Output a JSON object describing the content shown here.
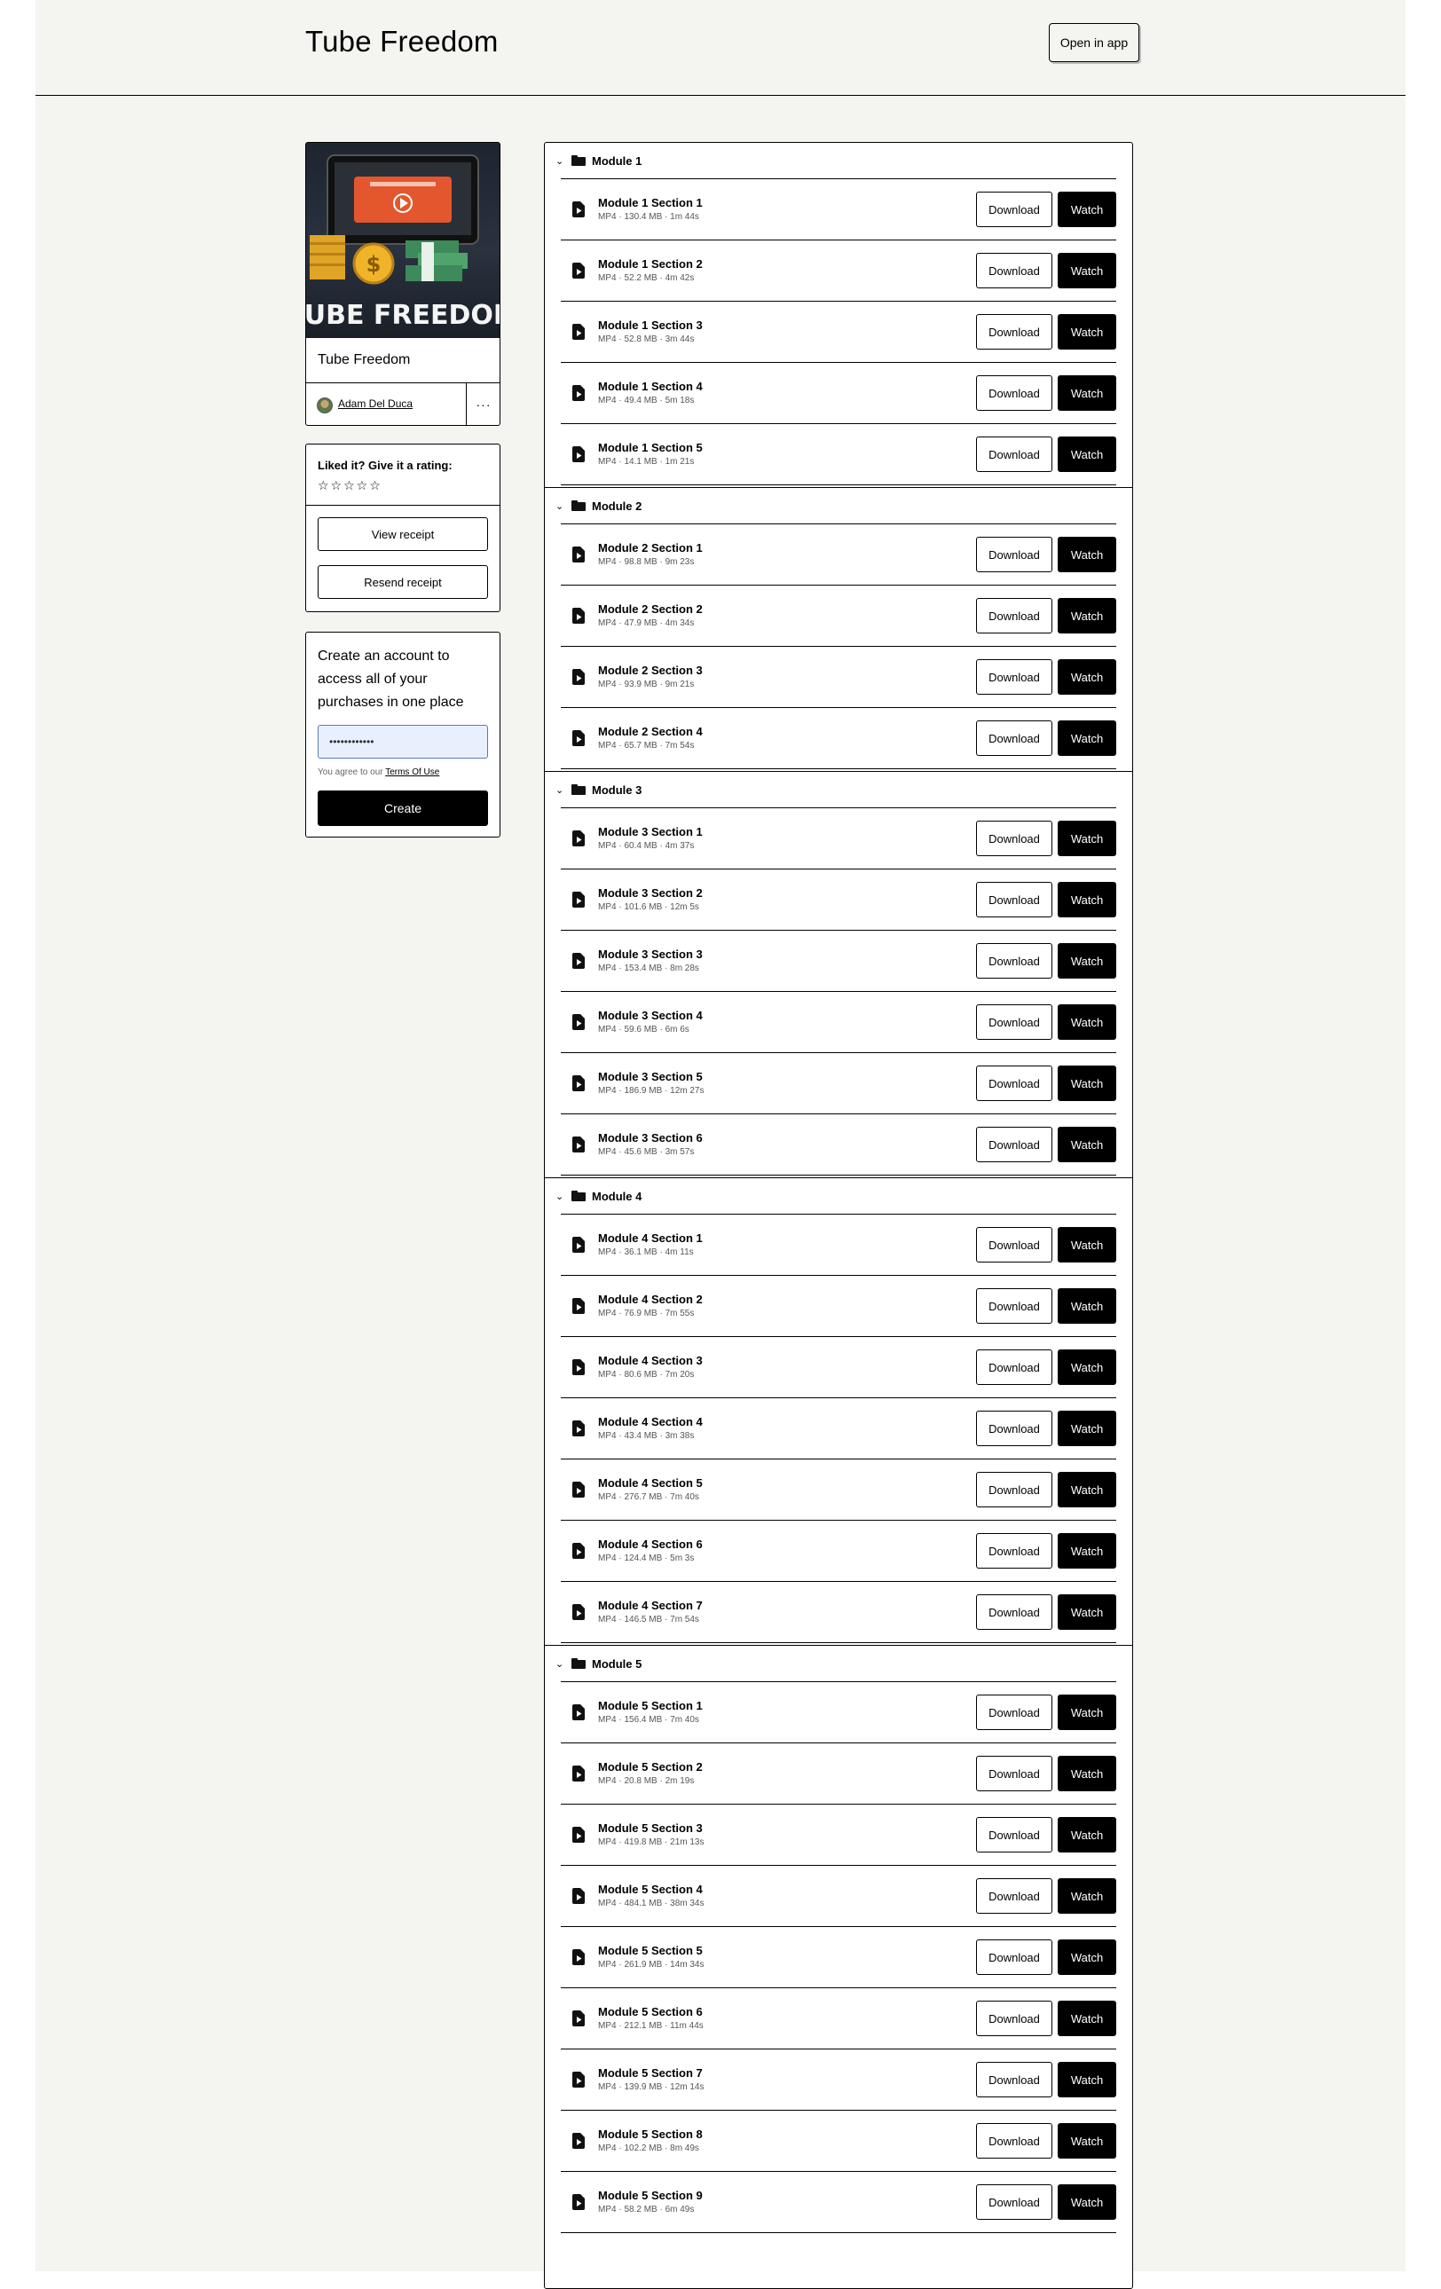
{
  "header": {
    "title": "Tube Freedom",
    "open_app_label": "Open in app"
  },
  "product": {
    "name": "Tube Freedom",
    "thumbnail_title": "TUBE FREEDOM",
    "seller": "Adam Del Duca",
    "more_label": "···"
  },
  "rating": {
    "label": "Liked it? Give it a rating:",
    "stars": "☆☆☆☆☆",
    "view_receipt": "View receipt",
    "resend_receipt": "Resend receipt"
  },
  "account": {
    "text": "Create an account to access all of your purchases in one place",
    "password_value": "••••••••••••",
    "terms_prefix": "You agree to our",
    "terms_link": "Terms Of Use",
    "create_label": "Create"
  },
  "labels": {
    "download": "Download",
    "watch": "Watch"
  },
  "modules": [
    {
      "name": "Module 1",
      "files": [
        {
          "name": "Module 1 Section 1",
          "meta": "MP4 · 130.4 MB · 1m 44s"
        },
        {
          "name": "Module 1 Section 2",
          "meta": "MP4 · 52.2 MB · 4m 42s"
        },
        {
          "name": "Module 1 Section 3",
          "meta": "MP4 · 52.8 MB · 3m 44s"
        },
        {
          "name": "Module 1 Section 4",
          "meta": "MP4 · 49.4 MB · 5m 18s"
        },
        {
          "name": "Module 1 Section 5",
          "meta": "MP4 · 14.1 MB · 1m 21s"
        }
      ]
    },
    {
      "name": "Module 2",
      "files": [
        {
          "name": "Module 2 Section 1",
          "meta": "MP4 · 98.8 MB · 9m 23s"
        },
        {
          "name": "Module 2 Section 2",
          "meta": "MP4 · 47.9 MB · 4m 34s"
        },
        {
          "name": "Module 2 Section 3",
          "meta": "MP4 · 93.9 MB · 9m 21s"
        },
        {
          "name": "Module 2 Section 4",
          "meta": "MP4 · 65.7 MB · 7m 54s"
        }
      ]
    },
    {
      "name": "Module 3",
      "files": [
        {
          "name": "Module 3 Section 1",
          "meta": "MP4 · 60.4 MB · 4m 37s"
        },
        {
          "name": "Module 3 Section 2",
          "meta": "MP4 · 101.6 MB · 12m 5s"
        },
        {
          "name": "Module 3 Section 3",
          "meta": "MP4 · 153.4 MB · 8m 28s"
        },
        {
          "name": "Module 3 Section 4",
          "meta": "MP4 · 59.6 MB · 6m 6s"
        },
        {
          "name": "Module 3 Section 5",
          "meta": "MP4 · 186.9 MB · 12m 27s"
        },
        {
          "name": "Module 3 Section 6",
          "meta": "MP4 · 45.6 MB · 3m 57s"
        }
      ]
    },
    {
      "name": "Module 4",
      "files": [
        {
          "name": "Module 4 Section 1",
          "meta": "MP4 · 36.1 MB · 4m 11s"
        },
        {
          "name": "Module 4 Section 2",
          "meta": "MP4 · 76.9 MB · 7m 55s"
        },
        {
          "name": "Module 4 Section 3",
          "meta": "MP4 · 80.6 MB · 7m 20s"
        },
        {
          "name": "Module 4 Section 4",
          "meta": "MP4 · 43.4 MB · 3m 38s"
        },
        {
          "name": "Module 4 Section 5",
          "meta": "MP4 · 276.7 MB · 7m 40s"
        },
        {
          "name": "Module 4 Section 6",
          "meta": "MP4 · 124.4 MB · 5m 3s"
        },
        {
          "name": "Module 4 Section 7",
          "meta": "MP4 · 146.5 MB · 7m 54s"
        }
      ]
    },
    {
      "name": "Module 5",
      "files": [
        {
          "name": "Module 5 Section 1",
          "meta": "MP4 · 156.4 MB · 7m 40s"
        },
        {
          "name": "Module 5 Section 2",
          "meta": "MP4 · 20.8 MB · 2m 19s"
        },
        {
          "name": "Module 5 Section 3",
          "meta": "MP4 · 419.8 MB · 21m 13s"
        },
        {
          "name": "Module 5 Section 4",
          "meta": "MP4 · 484.1 MB · 38m 34s"
        },
        {
          "name": "Module 5 Section 5",
          "meta": "MP4 · 261.9 MB · 14m 34s"
        },
        {
          "name": "Module 5 Section 6",
          "meta": "MP4 · 212.1 MB · 11m 44s"
        },
        {
          "name": "Module 5 Section 7",
          "meta": "MP4 · 139.9 MB · 12m 14s"
        },
        {
          "name": "Module 5 Section 8",
          "meta": "MP4 · 102.2 MB · 8m 49s"
        },
        {
          "name": "Module 5 Section 9",
          "meta": "MP4 · 58.2 MB · 6m 49s"
        }
      ]
    }
  ]
}
